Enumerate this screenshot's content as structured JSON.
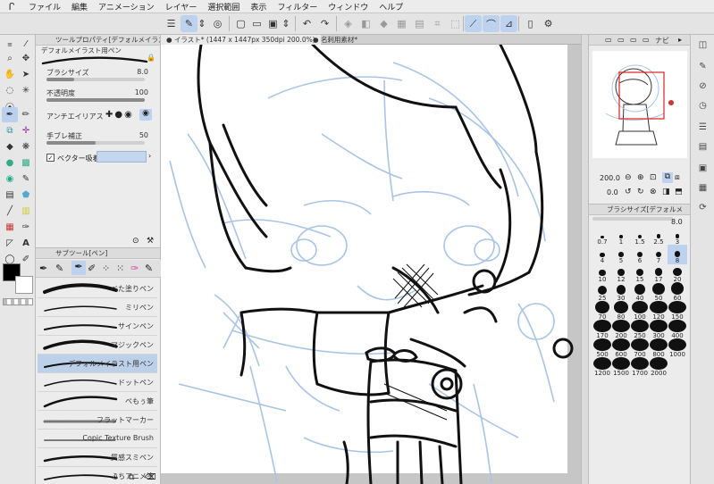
{
  "menu": {
    "logo": "ᒋ",
    "items": [
      "ファイル",
      "編集",
      "アニメーション",
      "レイヤー",
      "選択範囲",
      "表示",
      "フィルター",
      "ウィンドウ",
      "ヘルプ"
    ]
  },
  "tool_property": {
    "tab_title": "ツールプロパティ[デフォルメイラスト用ペン]",
    "brush_name": "デフォルメイラスト用ペン",
    "brush_size_label": "ブラシサイズ",
    "brush_size_value": "8.0",
    "brush_size_fraction": 0.28,
    "opacity_label": "不透明度",
    "opacity_value": "100",
    "opacity_fraction": 1.0,
    "antialias_label": "アンチエイリアス",
    "stabilization_label": "手ブレ補正",
    "stabilization_value": "50",
    "stabilization_fraction": 0.5,
    "vector_label": "ベクター吸着"
  },
  "sub_tool": {
    "tab_title": "サブツール[ペン]",
    "brushes": [
      {
        "name": "べた塗りペン",
        "selected": false
      },
      {
        "name": "ミリペン",
        "selected": false
      },
      {
        "name": "サインペン",
        "selected": false
      },
      {
        "name": "マジックペン",
        "selected": false
      },
      {
        "name": "デフォルメイラスト用ペン",
        "selected": true
      },
      {
        "name": "ドットペン",
        "selected": false
      },
      {
        "name": "ペもぅ筆",
        "selected": false
      },
      {
        "name": "フラットマーカー",
        "selected": false
      },
      {
        "name": "Copic Texture Brush",
        "selected": false
      },
      {
        "name": "質感スミペン",
        "selected": false
      },
      {
        "name": "ふちアニメ塗",
        "selected": false
      }
    ]
  },
  "canvas_tabs": [
    {
      "label": "イラスト* (1447 x 1447px 350dpi 200.0%)",
      "active": true
    },
    {
      "label": "名刺用素材*",
      "active": false
    }
  ],
  "navigator": {
    "tab_label": "ナビ",
    "zoom_value": "200.0",
    "rotate_value": "0.0"
  },
  "brush_size_palette": {
    "tab_title": "ブラシサイズ[デフォルメ",
    "top_value": "8.0",
    "sizes": [
      "0.7",
      "1",
      "1.5",
      "2.5",
      "3",
      "4",
      "5",
      "6",
      "7",
      "8",
      "10",
      "12",
      "15",
      "17",
      "20",
      "25",
      "30",
      "40",
      "50",
      "60",
      "70",
      "80",
      "100",
      "120",
      "150",
      "170",
      "200",
      "250",
      "300",
      "400",
      "500",
      "600",
      "700",
      "800",
      "1000",
      "1200",
      "1500",
      "1700",
      "2000"
    ],
    "selected": "8"
  },
  "colors": {
    "accent": "#bcd2ee",
    "main_color": "#000000",
    "sub_color": "#ffffff",
    "sketch_line": "#a9c4e6",
    "ink_line": "#111111"
  }
}
